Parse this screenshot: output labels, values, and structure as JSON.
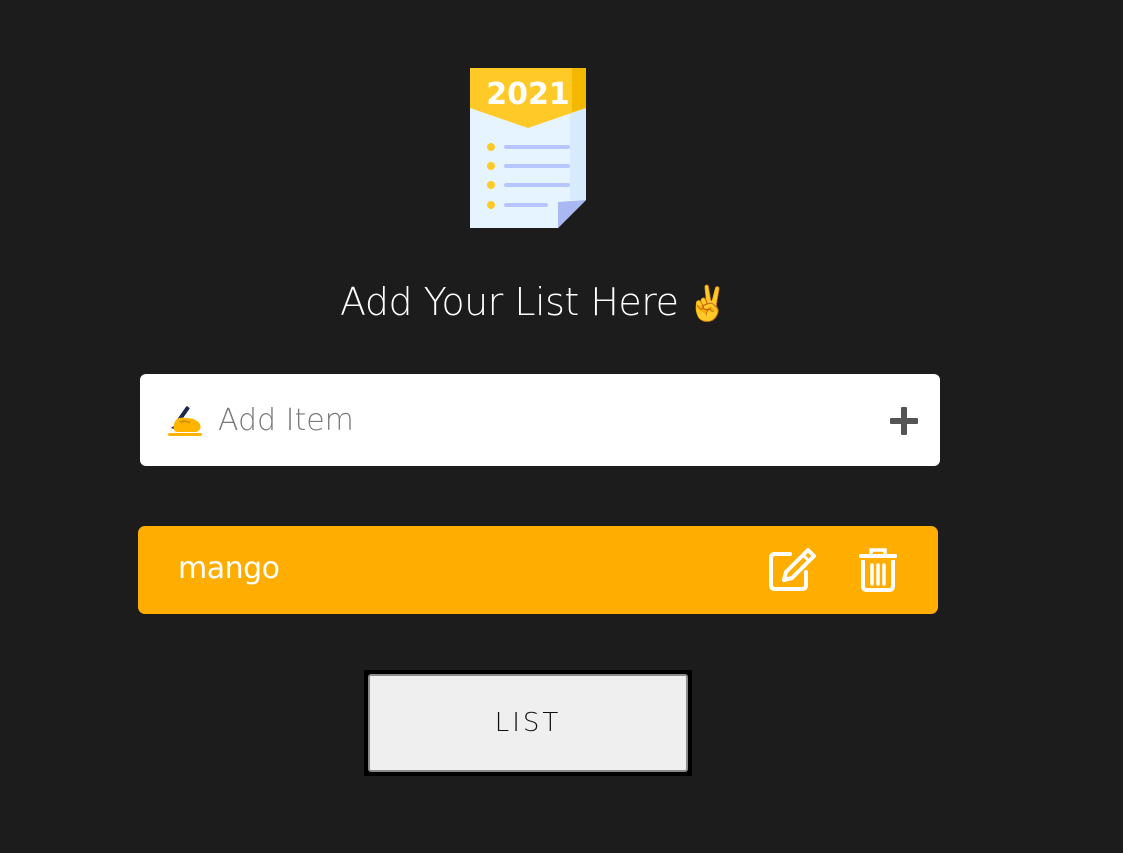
{
  "logo": {
    "year": "2021"
  },
  "heading": {
    "text": "Add Your List Here",
    "emoji": "✌️"
  },
  "add_item": {
    "placeholder": "Add Item",
    "value": "",
    "icon": "writing-hand-icon",
    "add_icon": "plus-icon"
  },
  "items": [
    {
      "label": "mango",
      "edit_icon": "edit-icon",
      "delete_icon": "trash-icon"
    }
  ],
  "list_button": {
    "label": "LIST"
  },
  "colors": {
    "background": "#1c1c1c",
    "item_background": "#ffad00",
    "logo_header": "#ffc928",
    "logo_page": "#e6f4ff",
    "logo_lines": "#b8c6ff"
  }
}
